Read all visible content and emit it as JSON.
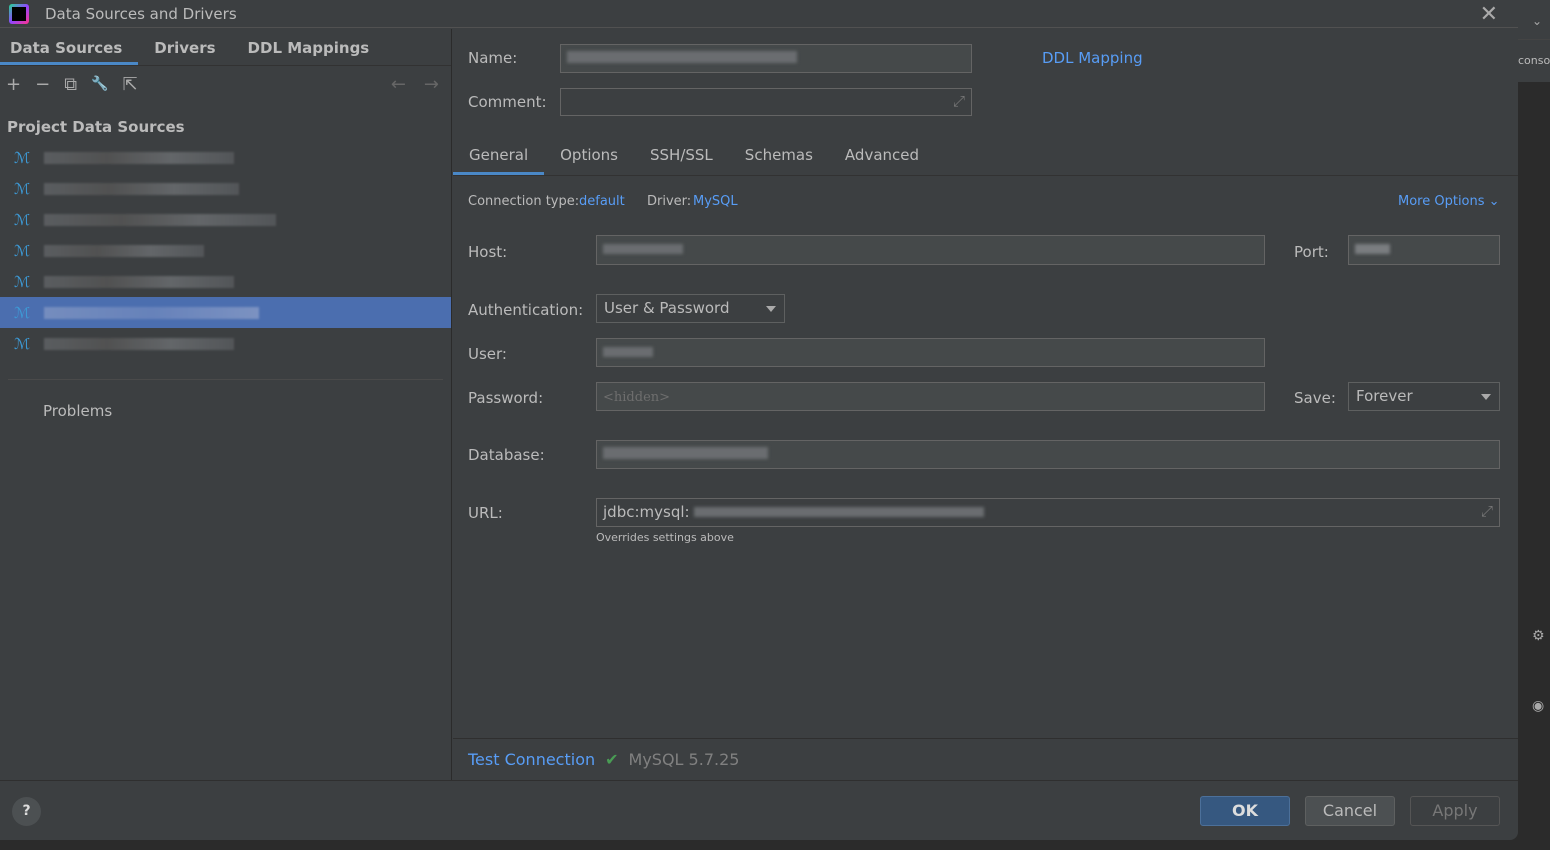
{
  "window": {
    "title": "Data Sources and Drivers",
    "close_icon": "close-icon"
  },
  "left": {
    "tabs": [
      {
        "label": "Data Sources",
        "active": true
      },
      {
        "label": "Drivers"
      },
      {
        "label": "DDL Mappings"
      }
    ],
    "toolbar": {
      "add": "+",
      "remove": "−",
      "copy": "⧉",
      "settings": "🔧",
      "import": "⇱",
      "back": "←",
      "forward": "→"
    },
    "section_title": "Project Data Sources",
    "data_sources_count": 7,
    "selected_index": 5,
    "problems_label": "Problems"
  },
  "form": {
    "name_label": "Name:",
    "ddl_mapping_link": "DDL Mapping",
    "comment_label": "Comment:",
    "comment_value": "",
    "tabs": [
      {
        "label": "General",
        "active": true
      },
      {
        "label": "Options"
      },
      {
        "label": "SSH/SSL"
      },
      {
        "label": "Schemas"
      },
      {
        "label": "Advanced"
      }
    ],
    "connection_type_label": "Connection type:",
    "connection_type_value": "default",
    "driver_label": "Driver:",
    "driver_value": "MySQL",
    "more_options": "More Options",
    "host_label": "Host:",
    "port_label": "Port:",
    "auth_label": "Authentication:",
    "auth_value": "User & Password",
    "user_label": "User:",
    "password_label": "Password:",
    "password_placeholder": "<hidden>",
    "save_label": "Save:",
    "save_value": "Forever",
    "database_label": "Database:",
    "url_label": "URL:",
    "url_value": "jdbc:mysql:",
    "url_hint": "Overrides settings above"
  },
  "test": {
    "link": "Test Connection",
    "result": "MySQL 5.7.25",
    "status_color": "#499c54"
  },
  "footer": {
    "help": "?",
    "ok": "OK",
    "cancel": "Cancel",
    "apply": "Apply"
  },
  "side": {
    "console_text": "conso"
  }
}
